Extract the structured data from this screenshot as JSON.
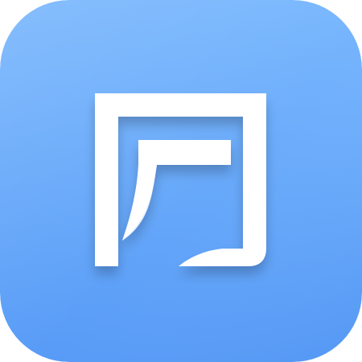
{
  "app_icon": {
    "name": "app-logo",
    "glyph": "logo-mark-icon",
    "colors": {
      "background_top": "#79B7FD",
      "background_bottom": "#579BF7",
      "mark": "#FFFFFF",
      "mark_shade": "#E9F1FE"
    }
  }
}
